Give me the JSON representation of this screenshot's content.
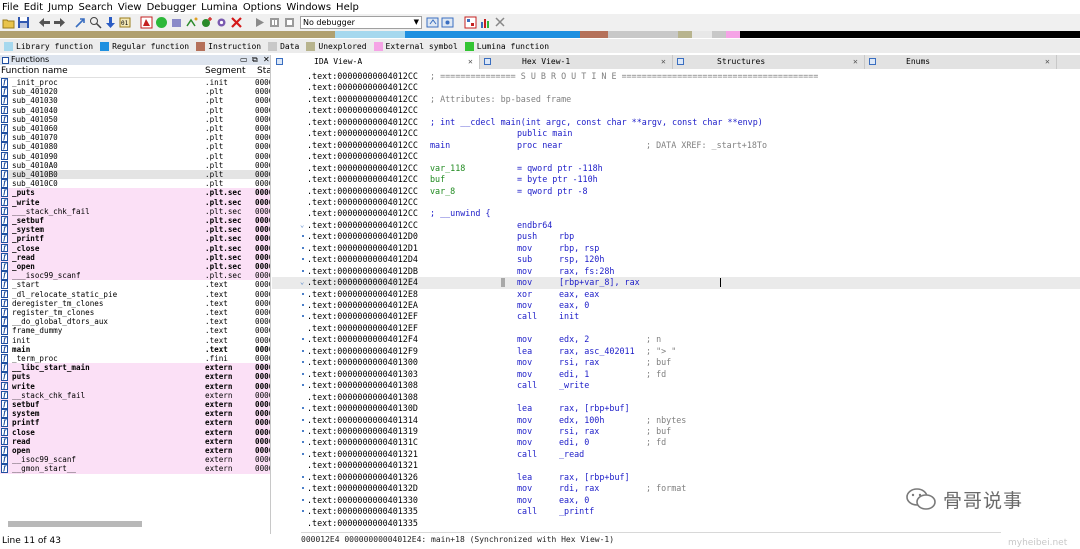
{
  "menu": [
    "File",
    "Edit",
    "Jump",
    "Search",
    "View",
    "Debugger",
    "Lumina",
    "Options",
    "Windows",
    "Help"
  ],
  "toolbar": {
    "debugger_select": "No debugger"
  },
  "legend": [
    {
      "label": "Library function",
      "color": "#a6d8ee"
    },
    {
      "label": "Regular function",
      "color": "#1e90e0"
    },
    {
      "label": "Instruction",
      "color": "#b5715a"
    },
    {
      "label": "Data",
      "color": "#c8c8c8"
    },
    {
      "label": "Unexplored",
      "color": "#b8b48e"
    },
    {
      "label": "External symbol",
      "color": "#f5a3e6"
    },
    {
      "label": "Lumina function",
      "color": "#33c433"
    }
  ],
  "functions_panel": {
    "title": "Functions",
    "col_name": "Function name",
    "col_segment": "Segment",
    "col_start": "Sta",
    "rows": [
      {
        "name": "_init_proc",
        "seg": ".init",
        "sta": "0000",
        "bold": false,
        "pink": false
      },
      {
        "name": "sub_401020",
        "seg": ".plt",
        "sta": "0000",
        "bold": false,
        "pink": false
      },
      {
        "name": "sub_401030",
        "seg": ".plt",
        "sta": "0000",
        "bold": false,
        "pink": false
      },
      {
        "name": "sub_401040",
        "seg": ".plt",
        "sta": "0000",
        "bold": false,
        "pink": false
      },
      {
        "name": "sub_401050",
        "seg": ".plt",
        "sta": "0000",
        "bold": false,
        "pink": false
      },
      {
        "name": "sub_401060",
        "seg": ".plt",
        "sta": "0000",
        "bold": false,
        "pink": false
      },
      {
        "name": "sub_401070",
        "seg": ".plt",
        "sta": "0000",
        "bold": false,
        "pink": false
      },
      {
        "name": "sub_401080",
        "seg": ".plt",
        "sta": "0000",
        "bold": false,
        "pink": false
      },
      {
        "name": "sub_401090",
        "seg": ".plt",
        "sta": "0000",
        "bold": false,
        "pink": false
      },
      {
        "name": "sub_4010A0",
        "seg": ".plt",
        "sta": "0000",
        "bold": false,
        "pink": false
      },
      {
        "name": "sub_4010B0",
        "seg": ".plt",
        "sta": "0000",
        "bold": false,
        "pink": false,
        "selected": true
      },
      {
        "name": "sub_4010C0",
        "seg": ".plt",
        "sta": "0000",
        "bold": false,
        "pink": false
      },
      {
        "name": "_puts",
        "seg": ".plt.sec",
        "sta": "0000",
        "bold": true,
        "pink": true
      },
      {
        "name": "_write",
        "seg": ".plt.sec",
        "sta": "0000",
        "bold": true,
        "pink": true
      },
      {
        "name": "___stack_chk_fail",
        "seg": ".plt.sec",
        "sta": "0000",
        "bold": false,
        "pink": true
      },
      {
        "name": "_setbuf",
        "seg": ".plt.sec",
        "sta": "0000",
        "bold": true,
        "pink": true
      },
      {
        "name": "_system",
        "seg": ".plt.sec",
        "sta": "0000",
        "bold": true,
        "pink": true
      },
      {
        "name": "_printf",
        "seg": ".plt.sec",
        "sta": "0000",
        "bold": true,
        "pink": true
      },
      {
        "name": "_close",
        "seg": ".plt.sec",
        "sta": "0000",
        "bold": true,
        "pink": true
      },
      {
        "name": "_read",
        "seg": ".plt.sec",
        "sta": "0000",
        "bold": true,
        "pink": true
      },
      {
        "name": "_open",
        "seg": ".plt.sec",
        "sta": "0000",
        "bold": true,
        "pink": true
      },
      {
        "name": "___isoc99_scanf",
        "seg": ".plt.sec",
        "sta": "0000",
        "bold": false,
        "pink": true
      },
      {
        "name": "_start",
        "seg": ".text",
        "sta": "0000",
        "bold": false,
        "pink": false
      },
      {
        "name": "_dl_relocate_static_pie",
        "seg": ".text",
        "sta": "0000",
        "bold": false,
        "pink": false
      },
      {
        "name": "deregister_tm_clones",
        "seg": ".text",
        "sta": "0000",
        "bold": false,
        "pink": false
      },
      {
        "name": "register_tm_clones",
        "seg": ".text",
        "sta": "0000",
        "bold": false,
        "pink": false
      },
      {
        "name": "__do_global_dtors_aux",
        "seg": ".text",
        "sta": "0000",
        "bold": false,
        "pink": false
      },
      {
        "name": "frame_dummy",
        "seg": ".text",
        "sta": "0000",
        "bold": false,
        "pink": false
      },
      {
        "name": "init",
        "seg": ".text",
        "sta": "0000",
        "bold": false,
        "pink": false
      },
      {
        "name": "main",
        "seg": ".text",
        "sta": "0000",
        "bold": true,
        "pink": false
      },
      {
        "name": "_term_proc",
        "seg": ".fini",
        "sta": "0000",
        "bold": false,
        "pink": false
      },
      {
        "name": "__libc_start_main",
        "seg": "extern",
        "sta": "0000",
        "bold": true,
        "pink": true
      },
      {
        "name": "puts",
        "seg": "extern",
        "sta": "0000",
        "bold": true,
        "pink": true
      },
      {
        "name": "write",
        "seg": "extern",
        "sta": "0000",
        "bold": true,
        "pink": true
      },
      {
        "name": "__stack_chk_fail",
        "seg": "extern",
        "sta": "0000",
        "bold": false,
        "pink": true
      },
      {
        "name": "setbuf",
        "seg": "extern",
        "sta": "0000",
        "bold": true,
        "pink": true
      },
      {
        "name": "system",
        "seg": "extern",
        "sta": "0000",
        "bold": true,
        "pink": true
      },
      {
        "name": "printf",
        "seg": "extern",
        "sta": "0000",
        "bold": true,
        "pink": true
      },
      {
        "name": "close",
        "seg": "extern",
        "sta": "0000",
        "bold": true,
        "pink": true
      },
      {
        "name": "read",
        "seg": "extern",
        "sta": "0000",
        "bold": true,
        "pink": true
      },
      {
        "name": "open",
        "seg": "extern",
        "sta": "0000",
        "bold": true,
        "pink": true
      },
      {
        "name": "__isoc99_scanf",
        "seg": "extern",
        "sta": "0000",
        "bold": false,
        "pink": true
      },
      {
        "name": "__gmon_start__",
        "seg": "extern",
        "sta": "0000",
        "bold": false,
        "pink": true
      }
    ],
    "status": "Line 11 of 43"
  },
  "tabs": [
    {
      "label": "IDA View-A",
      "active": true
    },
    {
      "label": "Hex View-1",
      "active": false
    },
    {
      "label": "Structures",
      "active": false
    },
    {
      "label": "Enums",
      "active": false
    }
  ],
  "listing": [
    {
      "addr": ".text:00000000004012CC",
      "full": "; =============== S U B R O U T I N E =======================================",
      "fullcolor": "#808080"
    },
    {
      "addr": ".text:00000000004012CC"
    },
    {
      "addr": ".text:00000000004012CC",
      "full": "; Attributes: bp-based frame",
      "fullcolor": "#808080"
    },
    {
      "addr": ".text:00000000004012CC"
    },
    {
      "addr": ".text:00000000004012CC",
      "full": "; int __cdecl main(int argc, const char **argv, const char **envp)",
      "fullcolor": "#1c1cc8"
    },
    {
      "addr": ".text:00000000004012CC",
      "mn": "public main"
    },
    {
      "addr": ".text:00000000004012CC",
      "label": "main",
      "mn": "proc near",
      "cm": "; DATA XREF: _start+18To"
    },
    {
      "addr": ".text:00000000004012CC"
    },
    {
      "addr": ".text:00000000004012CC",
      "label": "var_118",
      "mn": "= qword ptr -118h",
      "labelcolor": "#1f8a1f"
    },
    {
      "addr": ".text:00000000004012CC",
      "label": "buf",
      "mn": "= byte ptr -110h",
      "labelcolor": "#1f8a1f"
    },
    {
      "addr": ".text:00000000004012CC",
      "label": "var_8",
      "mn": "= qword ptr -8",
      "labelcolor": "#1f8a1f"
    },
    {
      "addr": ".text:00000000004012CC"
    },
    {
      "addr": ".text:00000000004012CC",
      "full": "; __unwind {",
      "fullcolor": "#1c1cc8"
    },
    {
      "addr": ".text:00000000004012CC",
      "mn": "endbr64",
      "gut": "chev"
    },
    {
      "addr": ".text:00000000004012D0",
      "mn": "push",
      "op": "rbp",
      "gut": "dot"
    },
    {
      "addr": ".text:00000000004012D1",
      "mn": "mov",
      "op": "rbp, rsp",
      "gut": "dot"
    },
    {
      "addr": ".text:00000000004012D4",
      "mn": "sub",
      "op": "rsp, 120h",
      "gut": "dot"
    },
    {
      "addr": ".text:00000000004012DB",
      "mn": "mov",
      "op": "rax, fs:28h",
      "gut": "dot"
    },
    {
      "addr": ".text:00000000004012E4",
      "mn": "mov",
      "op": "[rbp+var_8], rax",
      "gut": "chev",
      "hl": true
    },
    {
      "addr": ".text:00000000004012E8",
      "mn": "xor",
      "op": "eax, eax",
      "gut": "dot"
    },
    {
      "addr": ".text:00000000004012EA",
      "mn": "mov",
      "op": "eax, 0",
      "gut": "dot"
    },
    {
      "addr": ".text:00000000004012EF",
      "mn": "call",
      "op": "init",
      "gut": "dot"
    },
    {
      "addr": ".text:00000000004012EF"
    },
    {
      "addr": ".text:00000000004012F4",
      "mn": "mov",
      "op": "edx, 2",
      "cm": "; n",
      "gut": "dot"
    },
    {
      "addr": ".text:00000000004012F9",
      "mn": "lea",
      "op": "rax, asc_402011",
      "cm": "; \"> \"",
      "gut": "dot"
    },
    {
      "addr": ".text:0000000000401300",
      "mn": "mov",
      "op": "rsi, rax",
      "cm": "; buf",
      "gut": "dot"
    },
    {
      "addr": ".text:0000000000401303",
      "mn": "mov",
      "op": "edi, 1",
      "cm": "; fd",
      "gut": "dot"
    },
    {
      "addr": ".text:0000000000401308",
      "mn": "call",
      "op": "_write",
      "gut": "dot"
    },
    {
      "addr": ".text:0000000000401308"
    },
    {
      "addr": ".text:000000000040130D",
      "mn": "lea",
      "op": "rax, [rbp+buf]",
      "gut": "dot"
    },
    {
      "addr": ".text:0000000000401314",
      "mn": "mov",
      "op": "edx, 100h",
      "cm": "; nbytes",
      "gut": "dot"
    },
    {
      "addr": ".text:0000000000401319",
      "mn": "mov",
      "op": "rsi, rax",
      "cm": "; buf",
      "gut": "dot"
    },
    {
      "addr": ".text:000000000040131C",
      "mn": "mov",
      "op": "edi, 0",
      "cm": "; fd",
      "gut": "dot"
    },
    {
      "addr": ".text:0000000000401321",
      "mn": "call",
      "op": "_read",
      "gut": "dot"
    },
    {
      "addr": ".text:0000000000401321"
    },
    {
      "addr": ".text:0000000000401326",
      "mn": "lea",
      "op": "rax, [rbp+buf]",
      "gut": "dot"
    },
    {
      "addr": ".text:000000000040132D",
      "mn": "mov",
      "op": "rdi, rax",
      "cm": "; format",
      "gut": "dot"
    },
    {
      "addr": ".text:0000000000401330",
      "mn": "mov",
      "op": "eax, 0",
      "gut": "dot"
    },
    {
      "addr": ".text:0000000000401335",
      "mn": "call",
      "op": "_printf",
      "gut": "dot"
    },
    {
      "addr": ".text:0000000000401335"
    }
  ],
  "bottom_status": "000012E4 00000000004012E4: main+18 (Synchronized with Hex View-1)",
  "watermark": "骨哥说事",
  "watermark_small": "myheibei.net"
}
